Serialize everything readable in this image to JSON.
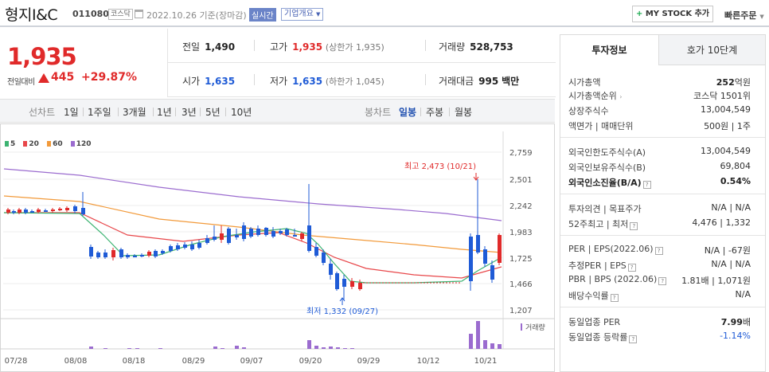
{
  "header": {
    "name": "형지I&C",
    "code": "011080",
    "market_badge": "코스닥",
    "date_text": "2022.10.26 기준(장마감)",
    "realtime_label": "실시간",
    "company_label": "기업개요",
    "mystock_label": "MY STOCK 추가",
    "quick_order_label": "빠른주문"
  },
  "quote": {
    "price": "1,935",
    "prev_label": "전일대비",
    "change": "445",
    "change_pct": "+29.87%",
    "prev_close_label": "전일",
    "prev_close": "1,490",
    "high_label": "고가",
    "high": "1,935",
    "high_note": "(상한가 1,935)",
    "volume_label": "거래량",
    "volume": "528,753",
    "open_label": "시가",
    "open": "1,635",
    "low_label": "저가",
    "low": "1,635",
    "low_note": "(하한가 1,045)",
    "amount_label": "거래대금",
    "amount": "995",
    "amount_unit": "백만"
  },
  "period_bar": {
    "line_label": "선차트",
    "line_items": [
      "1일",
      "1주일",
      "3개월",
      "1년",
      "3년",
      "5년",
      "10년"
    ],
    "candle_label": "봉차트",
    "candle_items": [
      "일봉",
      "주봉",
      "월봉"
    ],
    "candle_active": "일봉"
  },
  "chart_data": {
    "type": "candlestick",
    "legend": [
      {
        "name": "5",
        "color": "#3cb371"
      },
      {
        "name": "20",
        "color": "#e8474a"
      },
      {
        "name": "60",
        "color": "#f29a3a"
      },
      {
        "name": "120",
        "color": "#9b6ccf"
      }
    ],
    "y_ticks": [
      "2,759",
      "2,501",
      "2,242",
      "1,983",
      "1,725",
      "1,466",
      "1,207"
    ],
    "x_ticks": [
      "07/28",
      "08/08",
      "08/18",
      "08/29",
      "09/07",
      "09/20",
      "09/29",
      "10/12",
      "10/21"
    ],
    "high_annotation": "최고 2,473 (10/21)",
    "low_annotation": "최저 1,332 (09/27)",
    "volume_label": "거래량",
    "high_value": 2473,
    "low_value": 1332
  },
  "panel": {
    "tab_info": "투자정보",
    "tab_hoga": "호가 10단계",
    "market_cap_label": "시가총액",
    "market_cap": "252",
    "market_cap_unit": "억원",
    "market_cap_rank_label": "시가총액순위",
    "market_cap_rank": "코스닥 1501위",
    "shares_label": "상장주식수",
    "shares": "13,004,549",
    "par_label": "액면가 | 매매단위",
    "par": "500원 | 1주",
    "foreign_limit_label": "외국인한도주식수(A)",
    "foreign_limit": "13,004,549",
    "foreign_hold_label": "외국인보유주식수(B)",
    "foreign_hold": "69,804",
    "foreign_ratio_label": "외국인소진율(B/A)",
    "foreign_ratio": "0.54%",
    "opinion_label": "투자의견 | 목표주가",
    "opinion": "N/A | N/A",
    "week52_label": "52주최고 | 최저",
    "week52": "4,476 | 1,332",
    "per_label": "PER | EPS(2022.06)",
    "per": "N/A | -67원",
    "est_per_label": "추정PER | EPS",
    "est_per": "N/A | N/A",
    "pbr_label": "PBR | BPS (2022.06)",
    "pbr": "1.81배 | 1,071원",
    "dividend_label": "배당수익률",
    "dividend": "N/A",
    "sector_per_label": "동일업종 PER",
    "sector_per": "7.99",
    "sector_per_unit": "배",
    "sector_rate_label": "동일업종 등락률",
    "sector_rate": "-1.14%"
  }
}
